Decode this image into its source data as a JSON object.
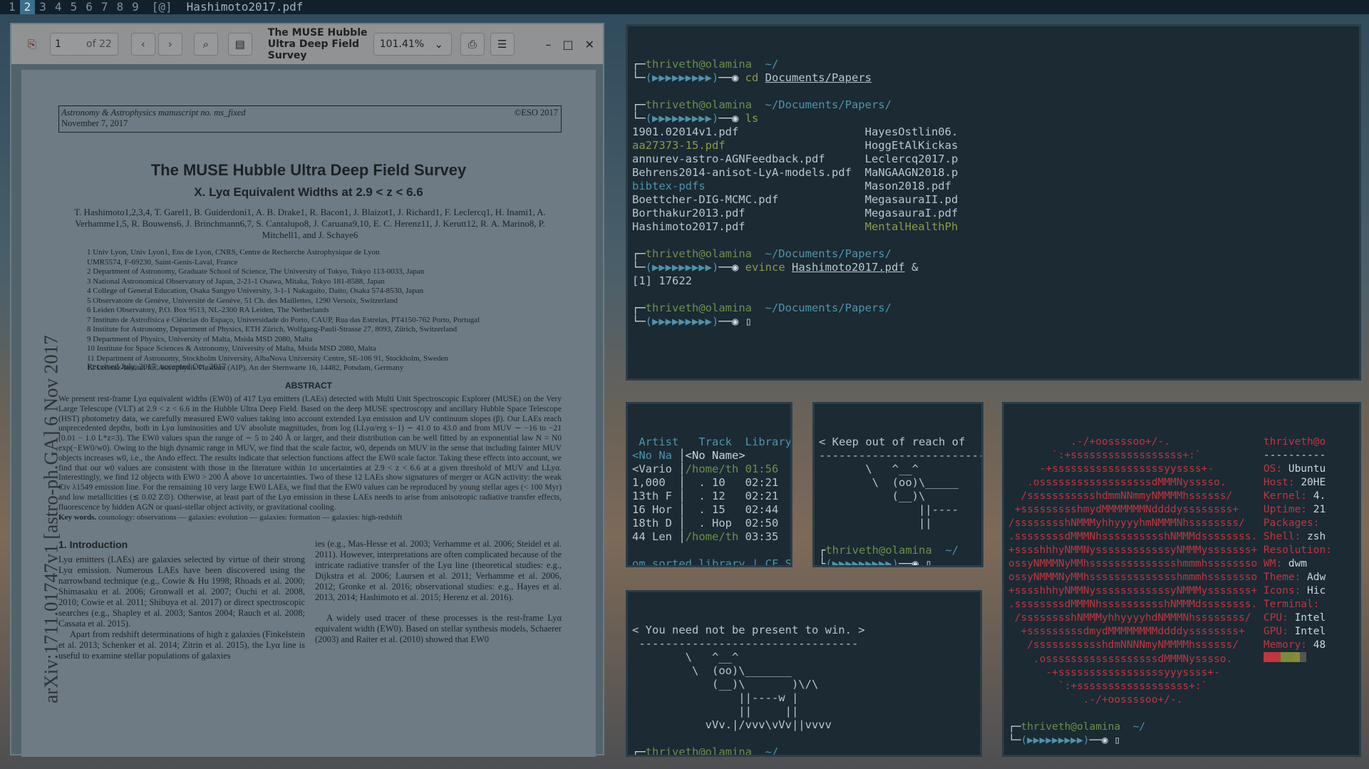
{
  "bar": {
    "workspaces": [
      "1",
      "2",
      "3",
      "4",
      "5",
      "6",
      "7",
      "8",
      "9"
    ],
    "active": "2",
    "layout": "[@]",
    "title": "Hashimoto2017.pdf"
  },
  "pdf": {
    "page_value": "1",
    "page_of": "of 22",
    "title": "The MUSE Hubble Ultra Deep Field Survey",
    "zoom": "101.41%",
    "header_left1": "Astronomy & Astrophysics manuscript no. ms_fixed",
    "header_left2": "November 7, 2017",
    "header_right": "©ESO 2017",
    "subtitle": "X. Lyα Equivalent Widths at 2.9 < z < 6.6",
    "authors": "T. Hashimoto1,2,3,4, T. Garel1, B. Guiderdoni1, A. B. Drake1, R. Bacon1, J. Blaizot1, J. Richard1, F. Leclercq1, H. Inami1, A. Verhamme1,5, R. Bouwens6, J. Brinchmann6,7, S. Cantalupo8, J. Caruana9,10, E. C. Herenz11, J. Kerutt12, R. A. Marino8, P. Mitchell1, and J. Schaye6",
    "affiliations": [
      "1  Univ Lyon, Univ Lyon1, Ens de Lyon, CNRS, Centre de Recherche Astrophysique de Lyon",
      "    UMR5574, F-69230, Saint-Genis-Laval, France",
      "2  Department of Astronomy, Graduate School of Science, The University of Tokyo, Tokyo 113-0033, Japan",
      "3  National Astronomical Observatory of Japan, 2-21-1 Osawa, Mitaka, Tokyo 181-8588, Japan",
      "4  College of General Education, Osaka Sangyo University, 3-1-1 Nakagaito, Daito, Osaka 574-8530, Japan",
      "5  Observatoire de Genève, Université de Genève, 51 Ch. des Maillettes, 1290 Versoix, Switzerland",
      "6  Leiden Observatory, P.O. Box 9513, NL-2300 RA Leiden, The Netherlands",
      "7  Instituto de Astrofísica e Ciências do Espaço, Universidade do Porto, CAUP, Rua das Estrelas, PT4150-762 Porto, Portugal",
      "8  Institute for Astronomy, Department of Physics, ETH Zürich, Wolfgang-Pauli-Strasse 27, 8093, Zürich, Switzerland",
      "9  Department of Physics, University of Malta, Msida MSD 2080, Malta",
      "10 Institute for Space Sciences & Astronomy, University of Malta, Msida MSD 2080, Malta",
      "11 Department of Astronomy, Stockholm University, AlbaNova University Centre, SE-106 91, Stockholm, Sweden",
      "12 Leibniz-Institut für Astrophysik Potsdam (AIP), An der Sternwarte 16, 14482, Potsdam, Germany"
    ],
    "received": "Received July, 2017; accepted Oct, 2017",
    "abstract_heading": "ABSTRACT",
    "abstract": "We present rest-frame Lyα equivalent widths (EW0) of 417 Lyα emitters (LAEs) detected with Multi Unit Spectroscopic Explorer (MUSE) on the Very Large Telescope (VLT) at 2.9 < z < 6.6 in the Hubble Ultra Deep Field. Based on the deep MUSE spectroscopy and ancillary Hubble Space Telescope (HST) photometry data, we carefully measured EW0 values taking into account extended Lyα emission and UV continuum slopes (β). Our LAEs reach unprecedented depths, both in Lyα luminosities and UV absolute magnitudes, from log (LLyα/erg s−1) ∼ 41.0 to 43.0 and from MUV ∼ −16 to −21 (0.01 − 1.0 L*z=3). The EW0 values span the range of ∼ 5 to 240 Å or larger, and their distribution can be well fitted by an exponential law N = N0 exp(−EW0/w0). Owing to the high dynamic range in MUV, we find that the scale factor, w0, depends on MUV in the sense that including fainter MUV objects increases w0, i.e., the Ando effect. The results indicate that selection functions affect the EW0 scale factor. Taking these effects into account, we find that our w0 values are consistent with those in the literature within 1σ uncertainties at 2.9 < z < 6.6 at a given threshold of MUV and LLyα. Interestingly, we find 12 objects with EW0 > 200 Å above 1σ uncertainties. Two of these 12 LAEs show signatures of merger or AGN activity: the weak Civ λ1549 emission line. For the remaining 10 very large EW0 LAEs, we find that the EW0 values can be reproduced by young stellar ages (< 100 Myr) and low metallicities (≲ 0.02 Z⊙). Otherwise, at least part of the Lyα emission in these LAEs needs to arise from anisotropic radiative transfer effects, fluorescence by hidden AGN or quasi-stellar object activity, or gravitational cooling.",
    "keywords_label": "Key words.",
    "keywords": "cosmology: observations — galaxies: evolution — galaxies: formation — galaxies: high-redshift",
    "intro_heading": "1. Introduction",
    "col1": "Lyα emitters (LAEs) are galaxies selected by virtue of their strong Lyα emission. Numerous LAEs have been discovered using the narrowband technique (e.g., Cowie & Hu 1998; Rhoads et al. 2000; Shimasaku et al. 2006; Gronwall et al. 2007; Ouchi et al. 2008, 2010; Cowie et al. 2011; Shibuya et al. 2017) or direct spectroscopic searches (e.g., Shapley et al. 2003; Santos 2004; Rauch et al. 2008; Cassata et al. 2015).",
    "col1b": "Apart from redshift determinations of high z galaxies (Finkelstein et al. 2013; Schenker et al. 2014; Zitrin et al. 2015), the Lyα line is useful to examine stellar populations of galaxies",
    "col2": "ies (e.g., Mas-Hesse et al. 2003; Verhamme et al. 2006; Steidel et al. 2011). However, interpretations are often complicated because of the intricate radiative transfer of the Lyα line (theoretical studies: e.g., Dijkstra et al. 2006; Laursen et al. 2011; Verhamme et al. 2006, 2012; Gronke et al. 2016; observational studies: e.g., Hayes et al. 2013, 2014; Hashimoto et al. 2015; Herenz et al. 2016).",
    "col2b": "A widely used tracer of these processes is the rest-frame Lyα equivalent width (EW0). Based on stellar synthesis models, Schaerer (2003) and Raiter et al. (2010) showed that EW0",
    "arxiv": "arXiv:1711.01747v1  [astro-ph.GA]  6 Nov 2017"
  },
  "term1": {
    "user": "thriveth@olamina",
    "lines": [
      {
        "type": "prompt",
        "path": "~/",
        "cmd": "cd",
        "arg": "Documents/Papers",
        "amp": ""
      },
      {
        "type": "prompt",
        "path": "~/Documents/Papers/",
        "cmd": "ls",
        "arg": "",
        "amp": ""
      }
    ],
    "ls_left": [
      "1901.02014v1.pdf",
      "aa27373-15.pdf",
      "annurev-astro-AGNFeedback.pdf",
      "Behrens2014-anisot-LyA-models.pdf",
      "bibtex-pdfs",
      "Boettcher-DIG-MCMC.pdf",
      "Borthakur2013.pdf",
      "Hashimoto2017.pdf"
    ],
    "ls_right": [
      "HayesOstlin06.",
      "HoggEtAlKickas",
      "Leclercq2017.p",
      "MaNGAAGN2018.p",
      "Mason2018.pdf",
      "MegasauraII.pd",
      "MegasauraI.pdf",
      "MentalHealthPh"
    ],
    "p3_path": "~/Documents/Papers/",
    "p3_cmd": "evince",
    "p3_arg": "Hashimoto2017.pdf",
    "p3_amp": "&",
    "job": "[1] 17622",
    "p4_path": "~/Documents/Papers/",
    "arrows": "(▶▶▶▶▶▶▶▶▶)"
  },
  "cmus": {
    "headers": [
      "Artist",
      "Track",
      "Library"
    ],
    "artists": [
      "<No Na",
      "<Vario",
      "1,000",
      "13th F",
      "16 Hor",
      "18th D",
      "44 Len"
    ],
    "tracks": [
      "<No Name>",
      "/home/th",
      "  . 10",
      "  . 12",
      "  . 15",
      "  . Hop",
      "/home/th"
    ],
    "times": [
      "",
      "01:56",
      "02:21",
      "02:21",
      "02:44",
      "02:50",
      "03:35"
    ],
    "status": "om sorted library | CF S"
  },
  "cow1": {
    "lines": [
      "< Keep out of reach of",
      "-------------------------",
      "       \\   ^__^",
      "        \\  (oo)\\_____",
      "           (__)\\    ",
      "               ||----",
      "               ||"
    ],
    "user": "thriveth@olamina",
    "path": "~/"
  },
  "cow2": {
    "lines": [
      "< You need not be present to win. >",
      " ---------------------------------",
      "        \\   ^__^",
      "         \\  (oo)\\_______",
      "            (__)\\       )\\/\\",
      "                ||----w |",
      "                ||     ||",
      "           vVv.|/vvv\\vVv||vvvv"
    ],
    "user": "thriveth@olamina",
    "path": "~/"
  },
  "neofetch": {
    "art": [
      "          .-/+oossssoo+/-.",
      "       `:+ssssssssssssssssss+:`",
      "     -+ssssssssssssssssssyyssss+-",
      "   .ossssssssssssssssssdMMMNysssso.",
      "  /ssssssssssshdmmNNmmyNMMMMhssssss/",
      " +ssssssssshmydMMMMMMMNddddyssssssss+",
      "/sssssssshNMMMyhhyyyyhmNMMMNhssssssss/",
      ".ssssssssdMMMNhsssssssssshNMMMdssssssss.",
      "+sssshhhyNMMNyssssssssssssyNMMMysssssss+",
      "ossyNMMMNyMMhsssssssssssssshmmmhssssssso",
      "ossyNMMMNyMMhsssssssssssssshmmmhssssssso",
      "+sssshhhyNMMNyssssssssssssyNMMMysssssss+",
      ".ssssssssdMMMNhsssssssssshNMMMdssssssss.",
      " /sssssssshNMMMyhhyyyyhdNMMMNhssssssss/",
      "  +sssssssssdmydMMMMMMMMddddyssssssss+",
      "   /ssssssssssshdmNNNNmyNMMMMhssssss/",
      "    .ossssssssssssssssssdMMMNysssso.",
      "      -+sssssssssssssssssyyyssss+-",
      "        `:+ssssssssssssssssss+:`",
      "            .-/+oossssoo+/-."
    ],
    "title": "thriveth@o",
    "sep": "----------",
    "info": [
      {
        "k": "OS",
        "v": "Ubuntu"
      },
      {
        "k": "Host",
        "v": "20HE"
      },
      {
        "k": "Kernel",
        "v": "4."
      },
      {
        "k": "Uptime",
        "v": "21"
      },
      {
        "k": "Packages",
        "v": ""
      },
      {
        "k": "Shell",
        "v": "zsh"
      },
      {
        "k": "Resolution",
        "v": ""
      },
      {
        "k": "WM",
        "v": "dwm"
      },
      {
        "k": "Theme",
        "v": "Adw"
      },
      {
        "k": "Icons",
        "v": "Hic"
      },
      {
        "k": "Terminal",
        "v": ""
      },
      {
        "k": "CPU",
        "v": "Intel"
      },
      {
        "k": "GPU",
        "v": "Intel"
      },
      {
        "k": "Memory",
        "v": "48"
      }
    ],
    "user": "thriveth@olamina",
    "path": "~/",
    "colors": {
      "accent_red": "#c2353f",
      "accent_green": "#7a8c3a"
    }
  }
}
